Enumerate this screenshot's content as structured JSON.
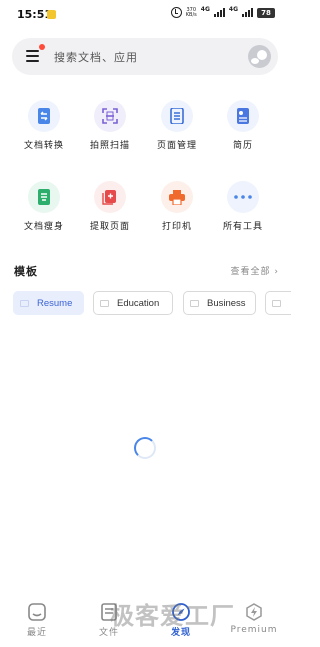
{
  "status_bar": {
    "time": "15:51",
    "net_speed_top": "370",
    "net_speed_bottom": "KB/s",
    "net_type_1": "4G",
    "net_type_2": "4G",
    "battery": "78",
    "icons": [
      "notification-icon",
      "alarm-icon",
      "signal-icon",
      "battery-icon"
    ]
  },
  "search": {
    "placeholder": "搜索文档、应用",
    "icons": [
      "menu-icon",
      "avatar-icon"
    ]
  },
  "tools": [
    {
      "label": "文档转换",
      "icon": "doc-convert-icon",
      "color": "#4a86e8",
      "bg": "#eef3fd"
    },
    {
      "label": "拍照扫描",
      "icon": "scan-icon",
      "color": "#7b61d6",
      "bg": "#f1eefb"
    },
    {
      "label": "页面管理",
      "icon": "page-manage-icon",
      "color": "#3a6fd8",
      "bg": "#eef3fd"
    },
    {
      "label": "简历",
      "icon": "resume-icon",
      "color": "#4a78e0",
      "bg": "#eef3fd"
    },
    {
      "label": "文档瘦身",
      "icon": "doc-slim-icon",
      "color": "#2eae6d",
      "bg": "#e8f7ef"
    },
    {
      "label": "提取页面",
      "icon": "extract-page-icon",
      "color": "#e64a4a",
      "bg": "#fdeeee"
    },
    {
      "label": "打印机",
      "icon": "printer-icon",
      "color": "#f06a2e",
      "bg": "#fdf0ea"
    },
    {
      "label": "所有工具",
      "icon": "more-dots-icon",
      "color": "#4a86e8",
      "bg": "#eef3fd"
    }
  ],
  "templates": {
    "title": "模板",
    "view_all": "查看全部 ›",
    "chips": [
      {
        "label": "Resume",
        "active": true
      },
      {
        "label": "Education",
        "active": false
      },
      {
        "label": "Business",
        "active": false
      },
      {
        "label": "",
        "active": false
      }
    ]
  },
  "loading": {
    "icon": "loading-spinner-icon"
  },
  "tabbar": [
    {
      "label": "最近",
      "icon": "recent-icon",
      "active": false
    },
    {
      "label": "文件",
      "icon": "file-icon",
      "active": false
    },
    {
      "label": "发现",
      "icon": "discover-icon",
      "active": true
    },
    {
      "label": "Premium",
      "icon": "premium-icon",
      "active": false
    }
  ],
  "watermark": "极客爱工厂",
  "colors": {
    "accent": "#2d5fd1",
    "chip_active_bg": "#e8eefb",
    "search_bg": "#f1f1f3"
  }
}
